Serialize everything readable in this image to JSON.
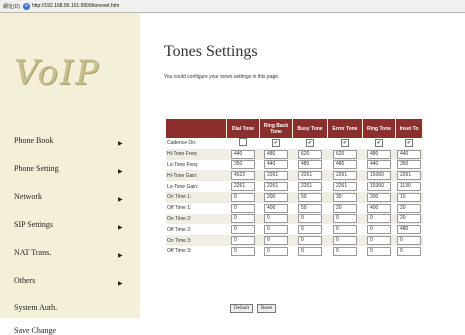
{
  "address_bar": {
    "label": "網址(D)",
    "url": "http://192.168.96.101:9999/toneset.htm"
  },
  "logo": "VoIP",
  "nav": [
    "Phone Book",
    "Phone Setting",
    "Network",
    "SIP Settings",
    "NAT Trans.",
    "Others",
    "System Auth.",
    "Save Change"
  ],
  "page": {
    "title": "Tones Settings",
    "description": "You could configure your tones settings in this page."
  },
  "table": {
    "columns": [
      "Dial Tone",
      "Ring Back Tone",
      "Busy Tone",
      "Error Tone",
      "Ring Tone",
      "Inset To"
    ],
    "rows": [
      {
        "label": "Cadence On:",
        "type": "checkbox",
        "values": [
          false,
          true,
          true,
          true,
          true,
          true
        ]
      },
      {
        "label": "Hi-Tone Freq:",
        "type": "input",
        "values": [
          "440",
          "480",
          "620",
          "620",
          "480",
          "440"
        ]
      },
      {
        "label": "Lo-Tone Freq:",
        "type": "input",
        "values": [
          "350",
          "440",
          "480",
          "480",
          "440",
          "350"
        ]
      },
      {
        "label": "Hi-Tone Gain:",
        "type": "input",
        "values": [
          "4522",
          "2261",
          "2261",
          "2261",
          "15360",
          "2261"
        ]
      },
      {
        "label": "Lo-Tone Gain:",
        "type": "input",
        "values": [
          "2261",
          "2261",
          "2261",
          "2261",
          "15360",
          "1130"
        ]
      },
      {
        "label": "On Time 1:",
        "type": "input",
        "values": [
          "0",
          "200",
          "50",
          "30",
          "200",
          "10"
        ]
      },
      {
        "label": "Off Time 1:",
        "type": "input",
        "values": [
          "0",
          "400",
          "50",
          "20",
          "400",
          "20"
        ]
      },
      {
        "label": "On Time 2:",
        "type": "input",
        "values": [
          "0",
          "0",
          "0",
          "0",
          "0",
          "20"
        ]
      },
      {
        "label": "Off Time 2:",
        "type": "input",
        "values": [
          "0",
          "0",
          "0",
          "0",
          "0",
          "480"
        ]
      },
      {
        "label": "On Time 3:",
        "type": "input",
        "values": [
          "0",
          "0",
          "0",
          "0",
          "0",
          "0"
        ]
      },
      {
        "label": "Off Time 3:",
        "type": "input",
        "values": [
          "0",
          "0",
          "0",
          "0",
          "0",
          "0"
        ]
      }
    ]
  },
  "buttons": {
    "default": "Default",
    "reset": "Reset"
  },
  "colors": {
    "sidebar_bg": "#f3efd9",
    "header_bg": "#8b2e2e",
    "logo": "#c8bf8e"
  }
}
